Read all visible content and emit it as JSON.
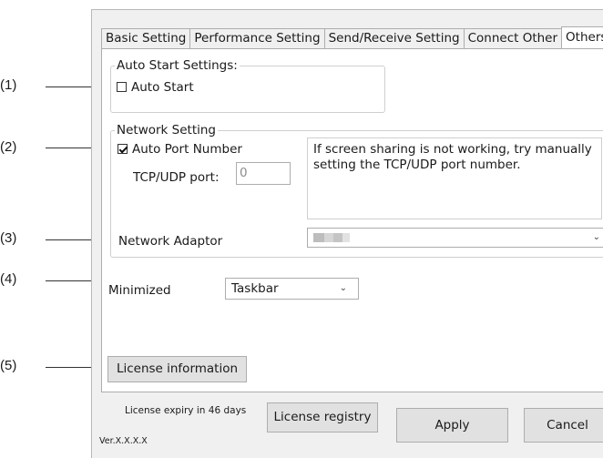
{
  "callouts": [
    "(1)",
    "(2)",
    "(3)",
    "(4)",
    "(5)"
  ],
  "tabs": [
    {
      "label": "Basic Setting"
    },
    {
      "label": "Performance Setting"
    },
    {
      "label": "Send/Receive Setting"
    },
    {
      "label": "Connect Other"
    },
    {
      "label": "Others",
      "active": true
    }
  ],
  "auto_start": {
    "group_title": "Auto Start Settings:",
    "checkbox_label": "Auto Start",
    "checked": false
  },
  "network": {
    "group_title": "Network Setting",
    "auto_port_label": "Auto Port Number",
    "auto_port_checked": true,
    "port_label": "TCP/UDP port:",
    "port_value": "0",
    "note": "If screen sharing is not working, try manually setting the TCP/UDP port number.",
    "adaptor_label": "Network Adaptor"
  },
  "minimized": {
    "label": "Minimized",
    "value": "Taskbar"
  },
  "license_info_button": "License information",
  "footer": {
    "expiry": "License expiry in 46 days",
    "registry_button": "License registry",
    "apply_button": "Apply",
    "cancel_button": "Cancel",
    "version": "Ver.X.X.X.X"
  },
  "icons": {
    "chevron": "chevron-down-icon",
    "check": "checkmark-icon"
  }
}
